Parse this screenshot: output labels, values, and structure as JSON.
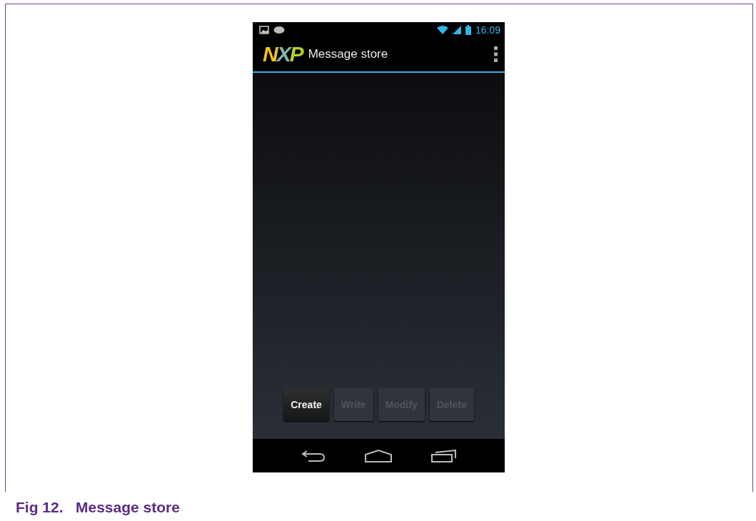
{
  "status_bar": {
    "time": "16:09"
  },
  "action_bar": {
    "logo": [
      {
        "letter": "N",
        "color": "#f2c21b"
      },
      {
        "letter": "X",
        "color": "#7fb6b0"
      },
      {
        "letter": "P",
        "color": "#b5cf2a"
      }
    ],
    "title": "Message store"
  },
  "buttons": [
    {
      "label": "Create",
      "disabled": false
    },
    {
      "label": "Write",
      "disabled": true
    },
    {
      "label": "Modify",
      "disabled": true
    },
    {
      "label": "Delete",
      "disabled": true
    }
  ],
  "caption": "Fig 12.   Message store"
}
